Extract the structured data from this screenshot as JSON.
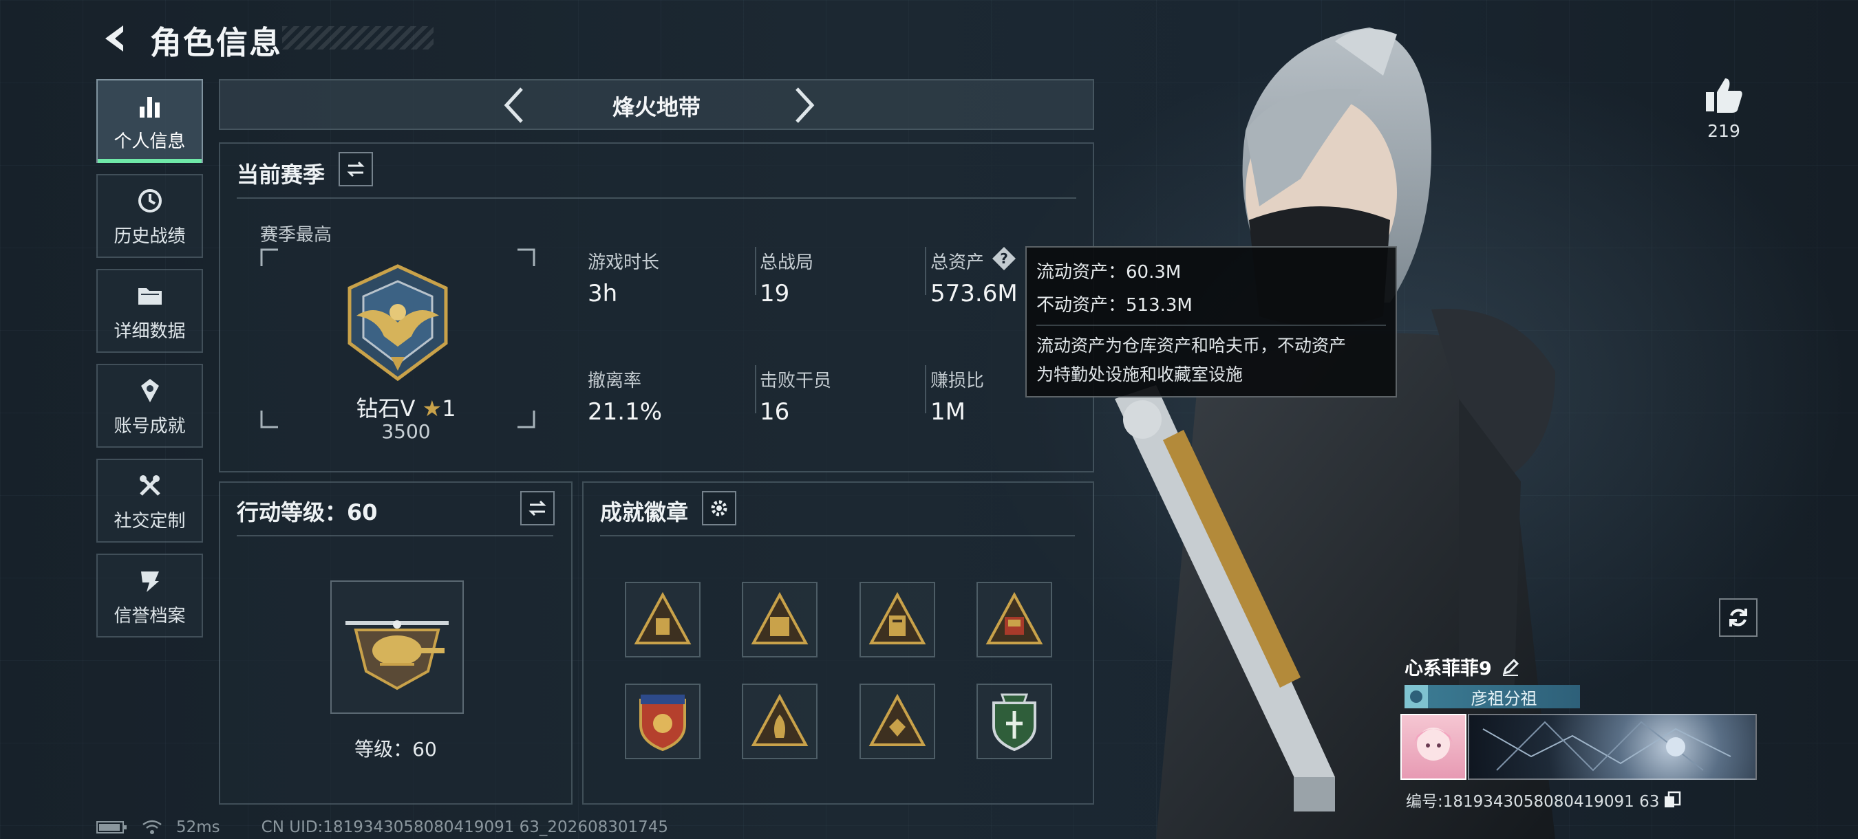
{
  "header": {
    "title": "角色信息"
  },
  "sidebar": {
    "items": [
      {
        "label": "个人信息",
        "icon": "bar-chart-icon",
        "active": true
      },
      {
        "label": "历史战绩",
        "icon": "history-icon"
      },
      {
        "label": "详细数据",
        "icon": "folder-icon"
      },
      {
        "label": "账号成就",
        "icon": "achievement-icon"
      },
      {
        "label": "社交定制",
        "icon": "tools-icon"
      },
      {
        "label": "信誉档案",
        "icon": "credit-icon"
      }
    ]
  },
  "mode": {
    "name": "烽火地带"
  },
  "season": {
    "title": "当前赛季",
    "best_label": "赛季最高",
    "rank_name": "钻石V",
    "rank_stars": "1",
    "rank_points": "3500",
    "stats": [
      {
        "label": "游戏时长",
        "value": "3h"
      },
      {
        "label": "总战局",
        "value": "19"
      },
      {
        "label": "总资产",
        "value": "573.6M"
      },
      {
        "label": "撤离率",
        "value": "21.1%"
      },
      {
        "label": "击败干员",
        "value": "16"
      },
      {
        "label": "赚损比",
        "value": "1M"
      }
    ],
    "help_mark": "?"
  },
  "tooltip": {
    "liquid": "流动资产：60.3M",
    "fixed": "不动资产：513.3M",
    "desc_line1": "流动资产为仓库资产和哈夫币，不动资产",
    "desc_line2": "为特勤处设施和收藏室设施"
  },
  "level": {
    "title": "行动等级：60",
    "label": "等级：60"
  },
  "achievements": {
    "title": "成就徽章",
    "badges": [
      "badge-1",
      "badge-2",
      "badge-3",
      "badge-4",
      "badge-5",
      "badge-6",
      "badge-7",
      "badge-8"
    ]
  },
  "likes": {
    "count": "219"
  },
  "player": {
    "name": "心系菲菲9",
    "clan": "彦祖分祖",
    "id": "编号:1819343058080419091 63"
  },
  "status": {
    "ping": "52ms",
    "uid": "CN UID:1819343058080419091 63_202608301745"
  },
  "colors": {
    "accent": "#6fe8a8",
    "panel": "#1c2832",
    "gold": "#c9a24a"
  }
}
